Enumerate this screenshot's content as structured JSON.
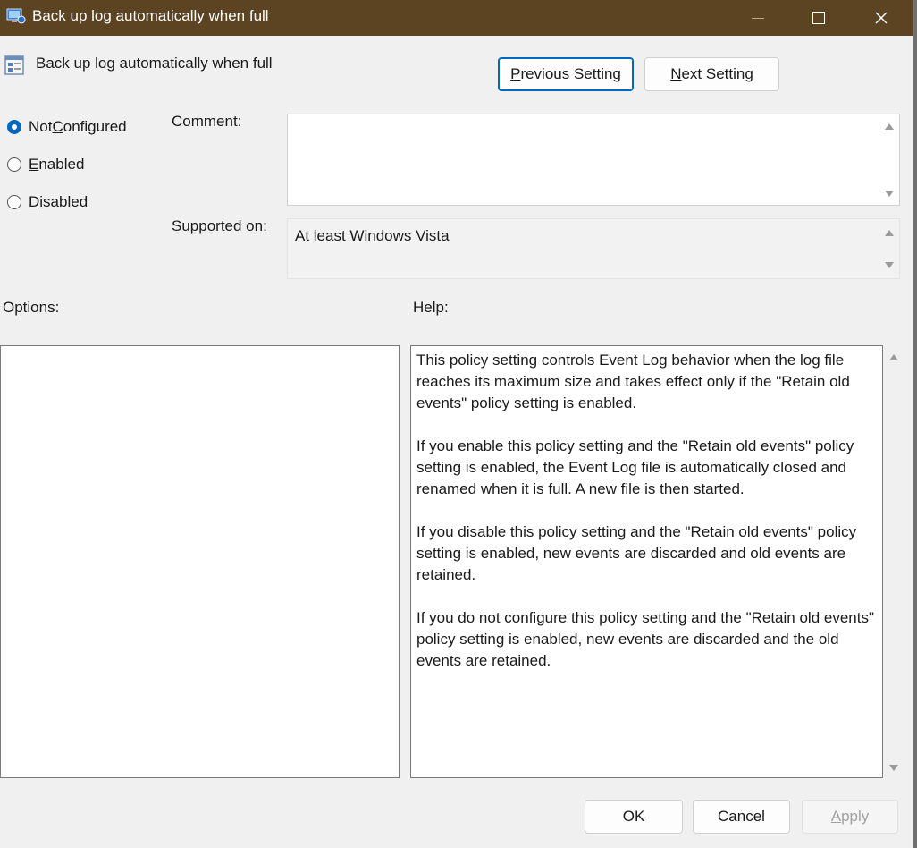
{
  "window": {
    "title": "Back up log automatically when full",
    "controls": {
      "minimize": "minimize",
      "maximize": "maximize",
      "close": "close"
    }
  },
  "header": {
    "policy_name": "Back up log automatically when full",
    "previous_setting": {
      "pre": "",
      "key": "P",
      "post": "revious Setting"
    },
    "next_setting": {
      "pre": "",
      "key": "N",
      "post": "ext Setting"
    }
  },
  "state": {
    "not_configured": {
      "pre": "Not ",
      "key": "C",
      "post": "onfigured",
      "checked": true
    },
    "enabled": {
      "pre": "",
      "key": "E",
      "post": "nabled",
      "checked": false
    },
    "disabled": {
      "pre": "",
      "key": "D",
      "post": "isabled",
      "checked": false
    }
  },
  "comment": {
    "label": "Comment:",
    "value": ""
  },
  "supported_on": {
    "label": "Supported on:",
    "value": "At least Windows Vista"
  },
  "options": {
    "label": "Options:"
  },
  "help": {
    "label": "Help:",
    "paragraphs": [
      "This policy setting controls Event Log behavior when the log file reaches its maximum size and takes effect only if the \"Retain old events\" policy setting is enabled.",
      "If you enable this policy setting and the \"Retain old events\" policy setting is enabled, the Event Log file is automatically closed and renamed when it is full. A new file is then started.",
      "If you disable this policy setting and the \"Retain old events\" policy setting is enabled, new events are discarded and old events are retained.",
      "If you do not configure this policy setting and the \"Retain old events\" policy setting is enabled, new events are discarded and the old events are retained."
    ]
  },
  "footer": {
    "ok": "OK",
    "cancel": "Cancel",
    "apply": {
      "pre": "",
      "key": "A",
      "post": "pply",
      "enabled": false
    }
  },
  "colors": {
    "titlebar": "#5c4321",
    "accent": "#0067c0",
    "dialog_bg": "#f0f0f0"
  }
}
